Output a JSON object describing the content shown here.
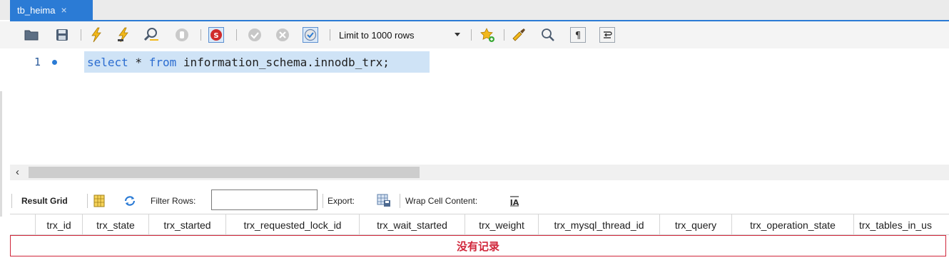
{
  "tab": {
    "title": "tb_heima",
    "close_glyph": "×"
  },
  "toolbar": {
    "icons": [
      "open-folder-icon",
      "save-icon",
      "execute-lightning-icon",
      "execute-cursor-lightning-icon",
      "explain-magnifier-icon",
      "stop-icon",
      "toggle-error-stop-icon",
      "commit-icon",
      "rollback-icon",
      "autocommit-icon",
      "add-snippet-star-icon",
      "beautify-brush-icon",
      "find-icon",
      "invisible-chars-icon",
      "word-wrap-icon"
    ],
    "limit_label": "Limit to 1000 rows"
  },
  "editor": {
    "line_number": "1",
    "code": {
      "kw_select": "select",
      "star": " * ",
      "kw_from": "from",
      "rest": " information_schema.innodb_trx;"
    }
  },
  "result_toolbar": {
    "result_grid_label": "Result Grid",
    "filter_rows_label": "Filter Rows:",
    "filter_value": "",
    "export_label": "Export:",
    "wrap_label": "Wrap Cell Content:"
  },
  "grid": {
    "columns": [
      "trx_id",
      "trx_state",
      "trx_started",
      "trx_requested_lock_id",
      "trx_wait_started",
      "trx_weight",
      "trx_mysql_thread_id",
      "trx_query",
      "trx_operation_state",
      "trx_tables_in_us"
    ],
    "empty_message": "没有记录"
  },
  "colors": {
    "accent": "#2b7bd5",
    "selection": "#cfe3f6",
    "empty_border": "#d0263a"
  }
}
